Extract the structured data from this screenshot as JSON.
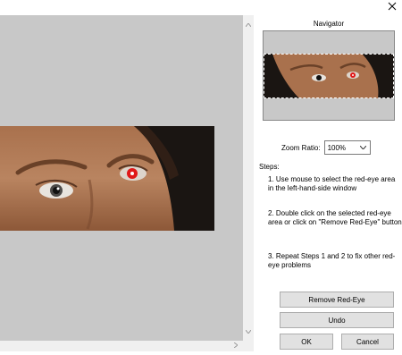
{
  "window": {
    "close_icon": "close-icon"
  },
  "canvas": {
    "photo_subject": "face with red-eye"
  },
  "navigator": {
    "title": "Navigator"
  },
  "zoom": {
    "label": "Zoom Ratio:",
    "value": "100%"
  },
  "steps": {
    "title": "Steps:",
    "items": [
      "1. Use mouse to select the red-eye area in the left-hand-side window",
      "2. Double click on the selected red-eye area or click on \"Remove Red-Eye\" button",
      "3. Repeat Steps 1 and 2 to fix other red-eye problems"
    ]
  },
  "buttons": {
    "remove": "Remove Red-Eye",
    "undo": "Undo",
    "ok": "OK",
    "cancel": "Cancel"
  },
  "colors": {
    "pane_bg": "#c8c8c8",
    "red_eye": "#e01818"
  }
}
